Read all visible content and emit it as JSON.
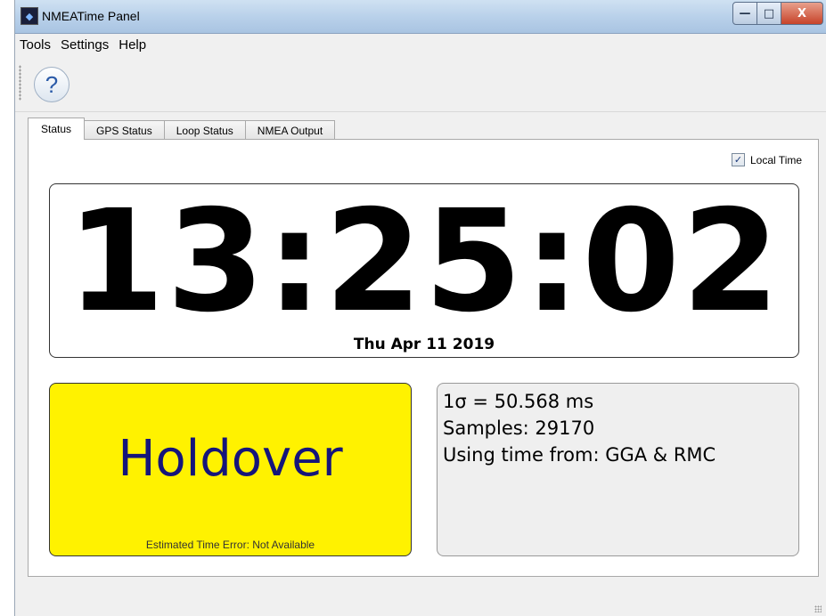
{
  "window": {
    "title": "NMEATime Panel"
  },
  "window_controls": {
    "minimize": "—",
    "maximize": "□",
    "close": "X"
  },
  "menu": {
    "items": [
      "Tools",
      "Settings",
      "Help"
    ]
  },
  "toolbar": {
    "help_label": "?"
  },
  "tabs": [
    {
      "label": "Status",
      "active": true
    },
    {
      "label": "GPS Status",
      "active": false
    },
    {
      "label": "Loop Status",
      "active": false
    },
    {
      "label": "NMEA Output",
      "active": false
    }
  ],
  "status": {
    "local_time_label": "Local Time",
    "local_time_checked": true,
    "checkmark": "✓",
    "clock": "13:25:02",
    "date": "Thu Apr 11 2019",
    "state": "Holdover",
    "estimated_error": "Estimated Time Error: Not Available",
    "sigma": "1σ = 50.568 ms",
    "samples": "Samples: 29170",
    "time_source": "Using time from: GGA & RMC"
  },
  "colors": {
    "holdover_bg": "#fff200",
    "holdover_text": "#15157a"
  }
}
